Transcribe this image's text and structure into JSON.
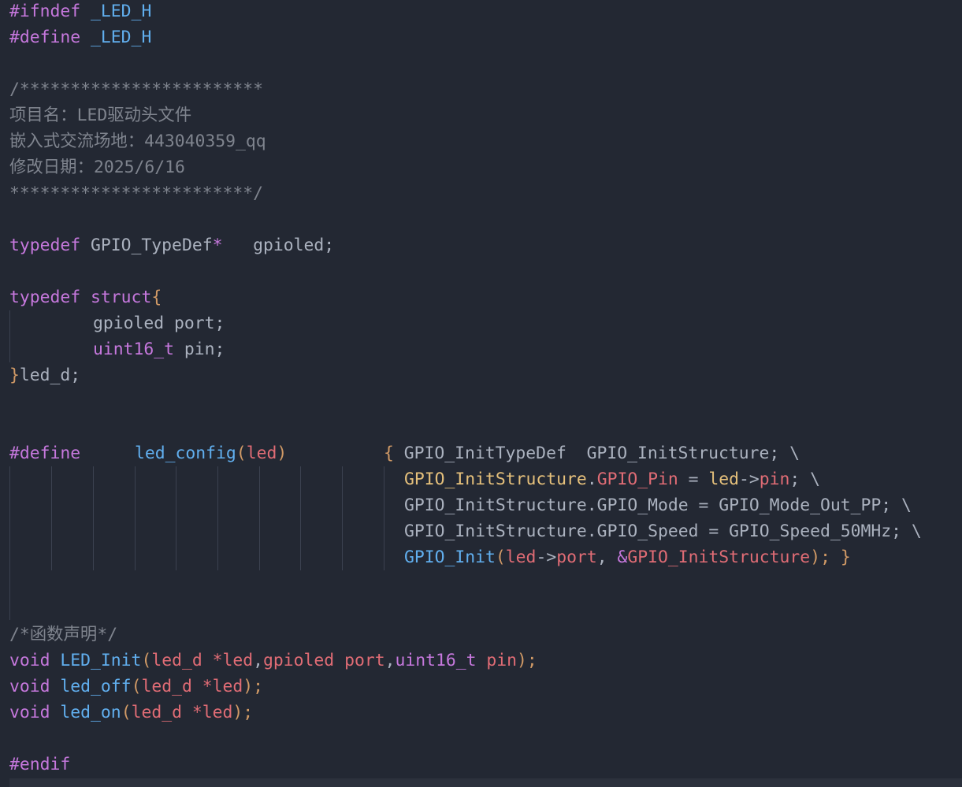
{
  "code": {
    "guard_ifndef": [
      "#ifndef",
      " ",
      "_LED_H"
    ],
    "guard_define": [
      "#define",
      " ",
      "_LED_H"
    ],
    "comment_header": [
      "/************************",
      "项目名：LED驱动头文件",
      "嵌入式交流场地：443040359_qq",
      "修改日期：2025/6/16",
      "************************/"
    ],
    "typedef_ptr": [
      "typedef",
      " GPIO_TypeDef",
      "*",
      "   gpioled;"
    ],
    "struct_open": [
      "typedef",
      " ",
      "struct",
      "{"
    ],
    "struct_port": [
      "gpioled port;"
    ],
    "struct_pin": [
      "uint16_t",
      " pin;"
    ],
    "struct_close": [
      "}",
      "led_d;"
    ],
    "macro_line1": [
      "#define",
      "led_config",
      "(",
      "led",
      ")",
      "{",
      " GPIO_InitTypeDef  GPIO_InitStructure; \\"
    ],
    "macro_line2": [
      "GPIO_InitStructure",
      ".",
      "GPIO_Pin",
      " = ",
      "led",
      "->",
      "pin",
      "; \\"
    ],
    "macro_line3": [
      "GPIO_InitStructure.GPIO_Mode = GPIO_Mode_Out_PP; \\"
    ],
    "macro_line4": [
      "GPIO_InitStructure.GPIO_Speed = GPIO_Speed_50MHz; \\"
    ],
    "macro_line5": [
      "GPIO_Init",
      "(",
      "led",
      "->",
      "port",
      ", ",
      "&",
      "GPIO_InitStructure",
      ");",
      " ",
      "}"
    ],
    "comment_decl": [
      "/*函数声明*/"
    ],
    "decl_init": [
      "void",
      " ",
      "LED_Init",
      "(",
      "led_d",
      " *",
      "led",
      ",",
      "gpioled",
      " ",
      "port",
      ",",
      "uint16_t",
      " ",
      "pin",
      ");"
    ],
    "decl_off": [
      "void",
      " ",
      "led_off",
      "(",
      "led_d",
      " *",
      "led",
      ");"
    ],
    "decl_on": [
      "void",
      " ",
      "led_on",
      "(",
      "led_d",
      " *",
      "led",
      ");"
    ],
    "endif": [
      "#endif"
    ]
  },
  "colors": {
    "background": "#232833",
    "keyword": "#c678dd",
    "function": "#61afef",
    "variable": "#e06c75",
    "type": "#e5c07b",
    "bracket": "#d19a66",
    "plain": "#abb2bf",
    "comment": "#7f848e"
  }
}
